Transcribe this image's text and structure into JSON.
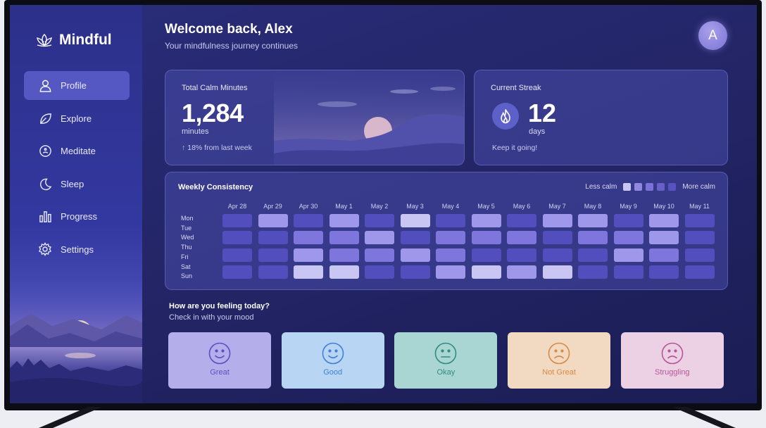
{
  "brand": {
    "name": "Mindful",
    "logo_icon": "lotus-icon"
  },
  "nav": [
    {
      "label": "Profile",
      "icon": "user-icon",
      "active": true
    },
    {
      "label": "Explore",
      "icon": "leaf-icon",
      "active": false
    },
    {
      "label": "Meditate",
      "icon": "meditate-icon",
      "active": false
    },
    {
      "label": "Sleep",
      "icon": "moon-icon",
      "active": false
    },
    {
      "label": "Progress",
      "icon": "bar-chart-icon",
      "active": false
    },
    {
      "label": "Settings",
      "icon": "gear-icon",
      "active": false
    }
  ],
  "header": {
    "welcome": "Welcome back, Alex",
    "subtitle": "Your mindfulness journey continues",
    "avatar_initial": "A"
  },
  "calm_card": {
    "label": "Total Calm Minutes",
    "value": "1,284",
    "unit": "minutes",
    "trend": "18% from last week"
  },
  "streak_card": {
    "label": "Current Streak",
    "value": "12",
    "unit": "days",
    "note": "Keep it going!"
  },
  "weekly": {
    "title": "Weekly Consistency",
    "legend_less": "Less calm",
    "legend_more": "More calm",
    "scale_colors": [
      "#c9c6f3",
      "#9f98ea",
      "#7e76dd",
      "#6760cc",
      "#524ebd"
    ],
    "dates": [
      "Apr 28",
      "Apr 29",
      "Apr 30",
      "May 1",
      "May 2",
      "May 3",
      "May 4",
      "May 5",
      "May 6",
      "May 7",
      "May 8",
      "May 9",
      "May 10",
      "May 11"
    ],
    "days": [
      "Mon",
      "Tue",
      "Wed",
      "Thu",
      "Fri",
      "Sat",
      "Sun"
    ],
    "levels": [
      [
        1,
        3,
        1,
        3,
        1,
        4,
        1,
        3,
        1,
        3,
        3,
        1,
        3,
        1
      ],
      [
        1,
        1,
        2,
        2,
        3,
        1,
        2,
        2,
        2,
        1,
        2,
        2,
        3,
        1
      ],
      [
        1,
        1,
        3,
        2,
        2,
        3,
        2,
        1,
        1,
        1,
        1,
        3,
        2,
        1
      ],
      [
        1,
        1,
        4,
        4,
        1,
        1,
        3,
        4,
        3,
        4,
        1,
        1,
        1,
        1
      ]
    ]
  },
  "mood": {
    "title": "How are you feeling today?",
    "subtitle": "Check in with your mood",
    "options": [
      {
        "label": "Great",
        "face": "smile",
        "bg": "#b4aeea",
        "fg": "#5a4fc4"
      },
      {
        "label": "Good",
        "face": "smile",
        "bg": "#b9d5f4",
        "fg": "#3f80d9"
      },
      {
        "label": "Okay",
        "face": "neutral",
        "bg": "#a9d6d2",
        "fg": "#2f8c80"
      },
      {
        "label": "Not Great",
        "face": "frown",
        "bg": "#f2d9c2",
        "fg": "#d98a45"
      },
      {
        "label": "Struggling",
        "face": "frown",
        "bg": "#ecd0e3",
        "fg": "#b8569a"
      }
    ]
  }
}
